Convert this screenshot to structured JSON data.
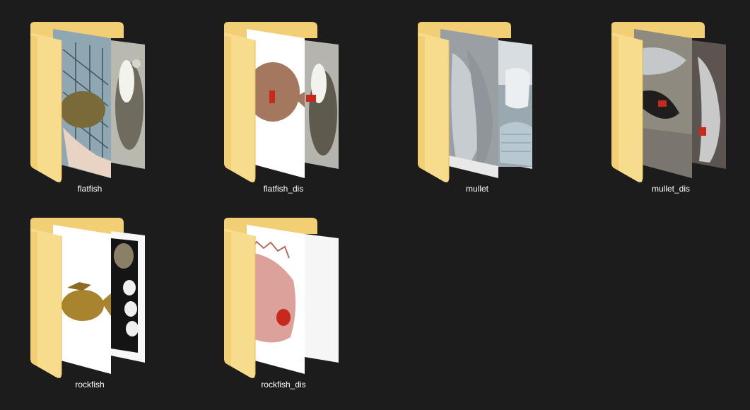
{
  "folders": [
    {
      "name": "flatfish",
      "icon": "folder-icon",
      "back_preview": "flatfish-on-ground",
      "front_preview": "flatfish-in-net",
      "front_bg": "#8fa7b2",
      "back_bg": "#b9b9b0",
      "lesion": false
    },
    {
      "name": "flatfish_dis",
      "icon": "folder-icon",
      "back_preview": "flatfish-with-lesion-on-ground",
      "front_preview": "flatfish-with-lesion-cutout",
      "front_bg": "#ffffff",
      "back_bg": "#b5b5ae",
      "lesion": true
    },
    {
      "name": "mullet",
      "icon": "folder-icon",
      "back_preview": "mullet-in-bucket",
      "front_preview": "mullets-on-net",
      "front_bg": "#9a9fa3",
      "back_bg": "#d8dde2",
      "lesion": false
    },
    {
      "name": "mullet_dis",
      "icon": "folder-icon",
      "back_preview": "mullet-with-lesion-in-hand",
      "front_preview": "mullet-with-lesion-on-gravel",
      "front_bg": "#8f8a80",
      "back_bg": "#5c5450",
      "lesion": true
    },
    {
      "name": "rockfish",
      "icon": "folder-icon",
      "back_preview": "rockfish-held-in-glove",
      "front_preview": "rockfish-cutout",
      "front_bg": "#ffffff",
      "back_bg": "#141414",
      "lesion": false
    },
    {
      "name": "rockfish_dis",
      "icon": "folder-icon",
      "back_preview": "blank-page",
      "front_preview": "red-rockfish-with-lesion",
      "front_bg": "#ffffff",
      "back_bg": "#f6f6f6",
      "lesion": true
    }
  ],
  "colors": {
    "background": "#1c1c1c",
    "folder_back": "#f2cf74",
    "folder_front": "#f8dc8e",
    "folder_edge": "#e6bd5a",
    "label_text": "#ffffff",
    "lesion_red": "#c9281f"
  }
}
